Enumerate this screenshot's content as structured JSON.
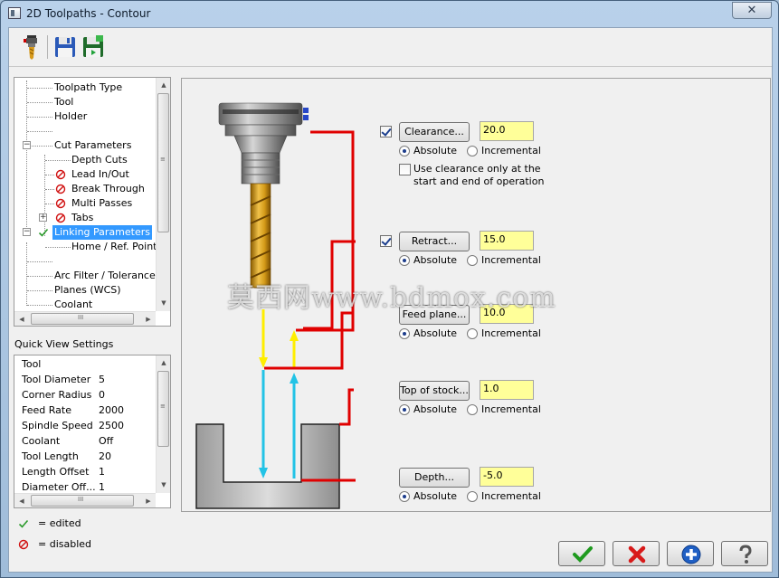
{
  "window": {
    "title": "2D Toolpaths - Contour",
    "close_glyph": "✕"
  },
  "toolbar": {
    "items": [
      {
        "icon": "tool-holder-icon"
      },
      {
        "icon": "save-icon"
      },
      {
        "icon": "save-to-library-icon"
      }
    ]
  },
  "tree": {
    "items": [
      {
        "label": "Toolpath Type"
      },
      {
        "label": "Tool"
      },
      {
        "label": "Holder"
      },
      {
        "label": "Cut Parameters"
      },
      {
        "label": "Depth Cuts"
      },
      {
        "label": "Lead In/Out"
      },
      {
        "label": "Break Through"
      },
      {
        "label": "Multi Passes"
      },
      {
        "label": "Tabs"
      },
      {
        "label": "Linking Parameters"
      },
      {
        "label": "Home / Ref. Points"
      },
      {
        "label": "Arc Filter / Tolerance"
      },
      {
        "label": "Planes (WCS)"
      },
      {
        "label": "Coolant"
      }
    ],
    "scroll_grip": "III"
  },
  "quick_view": {
    "title": "Quick View Settings",
    "rows": [
      {
        "label": "Tool",
        "value": ""
      },
      {
        "label": "Tool Diameter",
        "value": "5"
      },
      {
        "label": "Corner Radius",
        "value": "0"
      },
      {
        "label": "Feed Rate",
        "value": "2000"
      },
      {
        "label": "Spindle Speed",
        "value": "2500"
      },
      {
        "label": "Coolant",
        "value": "Off"
      },
      {
        "label": "Tool Length",
        "value": "20"
      },
      {
        "label": "Length Offset",
        "value": "1"
      },
      {
        "label": "Diameter Off...",
        "value": "1"
      }
    ],
    "scroll_grip": "III"
  },
  "legend": {
    "edited": "= edited",
    "disabled": "= disabled"
  },
  "params": {
    "clearance": {
      "button": "Clearance...",
      "value": "20.0",
      "checked": true,
      "absolute": "Absolute",
      "incremental": "Incremental",
      "note_line1": "Use clearance only at the",
      "note_line2": "start and end of operation"
    },
    "retract": {
      "button": "Retract...",
      "value": "15.0",
      "checked": true,
      "absolute": "Absolute",
      "incremental": "Incremental"
    },
    "feed_plane": {
      "button": "Feed plane...",
      "value": "10.0",
      "absolute": "Absolute",
      "incremental": "Incremental"
    },
    "top_of_stock": {
      "button": "Top of stock...",
      "value": "1.0",
      "absolute": "Absolute",
      "incremental": "Incremental"
    },
    "depth": {
      "button": "Depth...",
      "value": "-5.0",
      "absolute": "Absolute",
      "incremental": "Incremental"
    }
  },
  "watermark": "莫西网www.bdmox.com",
  "colors": {
    "accent_red": "#e00000",
    "feed_yellow": "#ffee00",
    "rapid_cyan": "#22c3e6",
    "input_bg": "#ffff99",
    "selection": "#3399ff"
  }
}
